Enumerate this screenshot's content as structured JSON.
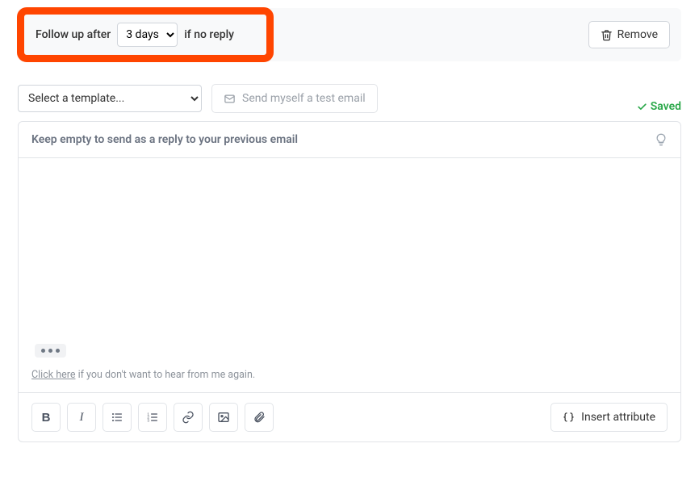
{
  "followup": {
    "before": "Follow up after",
    "after": "if no reply",
    "selected": "3 days"
  },
  "remove_label": "Remove",
  "template_placeholder": "Select a template...",
  "test_email_label": "Send myself a test email",
  "saved_label": "Saved",
  "subject_placeholder": "Keep empty to send as a reply to your previous email",
  "unsubscribe": {
    "link_text": "Click here",
    "rest": " if you don't want to hear from me again."
  },
  "insert_attr_label": "Insert attribute",
  "icons": {
    "trash": "trash-icon",
    "envelope": "envelope-icon",
    "bulb": "bulb-icon",
    "bold": "bold-icon",
    "italic": "italic-icon",
    "ul": "bullet-list-icon",
    "ol": "number-list-icon",
    "link": "link-icon",
    "image": "image-icon",
    "attach": "paperclip-icon",
    "braces": "braces-icon",
    "check": "check-icon"
  }
}
